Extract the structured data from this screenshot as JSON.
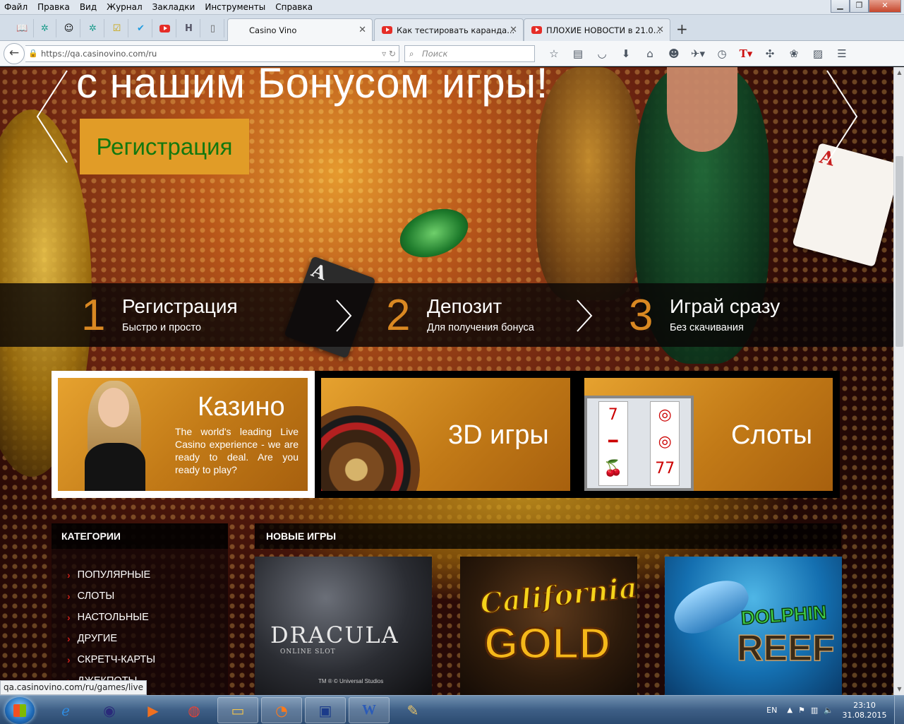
{
  "menu": [
    "Файл",
    "Правка",
    "Вид",
    "Журнал",
    "Закладки",
    "Инструменты",
    "Справка"
  ],
  "tabs": [
    {
      "label": "Casino Vino",
      "active": true
    },
    {
      "label": "Как тестировать каранда...",
      "active": false,
      "icon": "youtube-icon"
    },
    {
      "label": "ПЛОХИЕ НОВОСТИ в 21.0...",
      "active": false,
      "icon": "youtube-icon"
    }
  ],
  "address": {
    "url": "https://qa.casinovino.com/ru"
  },
  "search": {
    "placeholder": "Поиск"
  },
  "hero": {
    "title": "с нашим Бонусом игры!",
    "cta": "Регистрация"
  },
  "steps": [
    {
      "num": "1",
      "title": "Регистрация",
      "sub": "Быстро и просто"
    },
    {
      "num": "2",
      "title": "Депозит",
      "sub": "Для получения бонуса"
    },
    {
      "num": "3",
      "title": "Играй сразу",
      "sub": "Без скачивания"
    }
  ],
  "game_sections": {
    "casino": {
      "title": "Казино",
      "desc": "The world's leading Live Casino experience - we are ready to deal. Are you ready to play?"
    },
    "games3d": {
      "prefix": "3D",
      "title": "игры"
    },
    "slots": {
      "title": "Слоты"
    }
  },
  "categories": {
    "heading": "КАТЕГОРИИ",
    "items": [
      "ПОПУЛЯРНЫЕ",
      "СЛОТЫ",
      "НАСТОЛЬНЫЕ",
      "ДРУГИЕ",
      "СКРЕТЧ-КАРТЫ",
      "ДЖЕКПОТЫ"
    ]
  },
  "new_games": {
    "heading": "НОВЫЕ ИГРЫ",
    "items": [
      {
        "logo": "DRACULA",
        "sub": "ONLINE SLOT",
        "tm": "TM ® © Universal Studios"
      },
      {
        "logo_top": "California",
        "logo_bottom": "GOLD"
      },
      {
        "logo_top": "DOLPHIN",
        "logo_bottom": "REEF"
      }
    ]
  },
  "status_url": "qa.casinovino.com/ru/games/live",
  "taskbar": {
    "lang": "EN",
    "time": "23:10",
    "date": "31.08.2015"
  },
  "colors": {
    "accent": "#e19c27",
    "cta_text": "#12780f",
    "step_number": "#d98822",
    "category_caret": "#c8201a"
  }
}
